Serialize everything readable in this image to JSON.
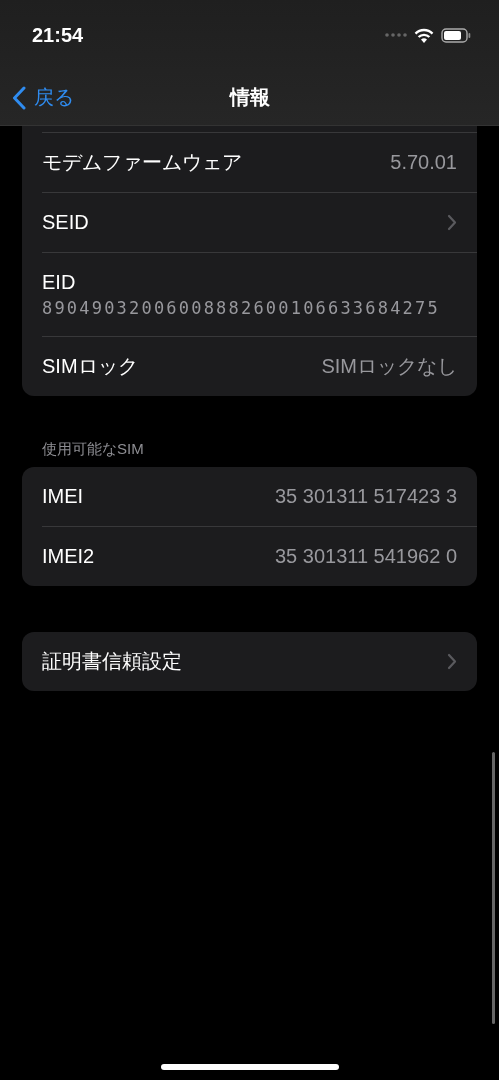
{
  "status_bar": {
    "time": "21:54"
  },
  "nav_bar": {
    "back": "戻る",
    "title": "情報"
  },
  "groups": [
    {
      "rows": [
        {
          "kind": "value",
          "label": "モデムファームウェア",
          "value": "5.70.01"
        },
        {
          "kind": "chevron",
          "label": "SEID"
        },
        {
          "kind": "stacked",
          "label": "EID",
          "value": "89049032006008882600106633684275"
        },
        {
          "kind": "value",
          "label": "SIMロック",
          "value": "SIMロックなし"
        }
      ]
    },
    {
      "header": "使用可能なSIM",
      "rows": [
        {
          "kind": "value",
          "label": "IMEI",
          "value": "35 301311 517423 3"
        },
        {
          "kind": "value",
          "label": "IMEI2",
          "value": "35 301311 541962 0"
        }
      ]
    },
    {
      "rows": [
        {
          "kind": "chevron",
          "label": "証明書信頼設定"
        }
      ]
    }
  ]
}
